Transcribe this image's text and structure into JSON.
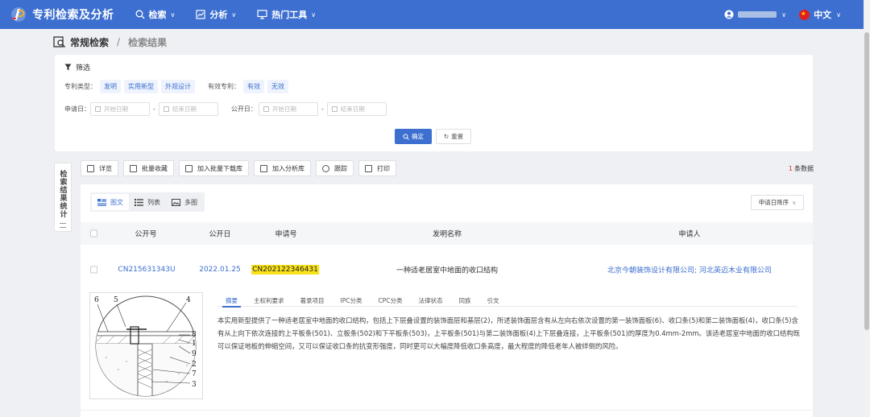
{
  "app": {
    "title": "专利检索及分析"
  },
  "nav": {
    "items": [
      {
        "label": "检索",
        "icon": "search-icon"
      },
      {
        "label": "分析",
        "icon": "chart-icon"
      },
      {
        "label": "热门工具",
        "icon": "monitor-icon"
      }
    ],
    "language": "中文"
  },
  "breadcrumb": {
    "root": "常规检索",
    "sep": "/",
    "current": "检索结果"
  },
  "filter": {
    "title": "筛选",
    "patent_type_label": "专利类型：",
    "patent_types": [
      "发明",
      "实用新型",
      "外观设计"
    ],
    "valid_label": "有效专利：",
    "valid_options": [
      "有效",
      "无效"
    ],
    "apply_date_label": "申请日：",
    "publish_date_label": "公开日：",
    "start_placeholder": "开始日期",
    "end_placeholder": "结束日期",
    "confirm": "确定",
    "reset": "重置"
  },
  "side_tab": {
    "label": "检索结果统计"
  },
  "toolbar": {
    "buttons": [
      "详览",
      "批量收藏",
      "加入批量下载库",
      "加入分析库",
      "跟踪",
      "打印"
    ],
    "count_num": "1",
    "count_text": "条数据"
  },
  "view": {
    "tabs": [
      "图文",
      "列表",
      "多图"
    ],
    "sort": "申请日降序"
  },
  "table": {
    "headers": [
      "公开号",
      "公开日",
      "申请号",
      "发明名称",
      "申请人"
    ],
    "row": {
      "pub_no": "CN215631343U",
      "pub_date": "2022.01.25",
      "app_no": "CN202122346431",
      "title": "一种适老居室中地面的收口结构",
      "applicant": "北京今朝装饰设计有限公司; 河北英迈木业有限公司"
    }
  },
  "detail": {
    "tabs": [
      "摘要",
      "主权利要求",
      "著录项目",
      "IPC分类",
      "CPC分类",
      "法律状态",
      "同族",
      "引文"
    ],
    "abstract": "本实用新型提供了一种适老居室中地面的收口结构，包括上下层叠设置的装饰面层和基层(2)，所述装饰面层含有从左向右依次设置的第一装饰面板(6)、收口条(5)和第二装饰面板(4)，收口条(5)含有从上向下依次连接的上平板条(501)、立板条(502)和下平板条(503)，上平板条(501)与第二装饰面板(4)上下层叠连接，上平板条(501)的厚度为0.4mm-2mm。该适老居室中地面的收口结构既可以保证地板的伸缩空间，又可以保证收口条的抗变形强度，同时更可以大幅度降低收口条高度，最大程度的降低老年人被绊倒的风险。",
    "drawing_labels": [
      "6",
      "5",
      "4",
      "8",
      "1",
      "9",
      "2",
      "7",
      "3"
    ]
  }
}
